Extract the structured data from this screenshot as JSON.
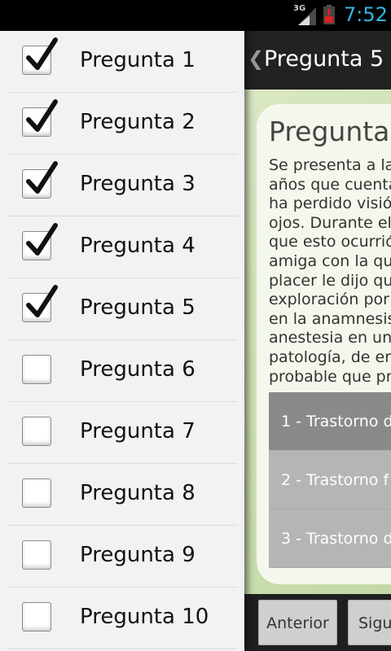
{
  "status_bar": {
    "network_label": "3G",
    "signal_icon": "signal-bars-icon",
    "battery_icon": "battery-low-icon",
    "time": "7:52",
    "time_color": "#33b5e5"
  },
  "content": {
    "action_bar": {
      "back_icon": "chevron-left-icon",
      "title": "Pregunta 5"
    },
    "question": {
      "title": "Pregunta",
      "text": "Se presenta a la\naños que cuenta\nha perdido visió\nojos. Durante el\nque esto ocurrió\namiga con la qu\nplacer le dijo que\nexploración por\nen la anamnesis\nanestesia en un\npatología, de ent\nprobable que pre"
    },
    "answers": [
      {
        "label": "1 - Trastorno d"
      },
      {
        "label": "2 - Trastorno f"
      },
      {
        "label": "3 - Trastorno d"
      }
    ],
    "buttons": {
      "previous": "Anterior",
      "next": "Sigu"
    }
  },
  "drawer": {
    "items": [
      {
        "label": "Pregunta 1",
        "checked": true
      },
      {
        "label": "Pregunta 2",
        "checked": true
      },
      {
        "label": "Pregunta 3",
        "checked": true
      },
      {
        "label": "Pregunta 4",
        "checked": true
      },
      {
        "label": "Pregunta 5",
        "checked": true
      },
      {
        "label": "Pregunta 6",
        "checked": false
      },
      {
        "label": "Pregunta 7",
        "checked": false
      },
      {
        "label": "Pregunta 8",
        "checked": false
      },
      {
        "label": "Pregunta 9",
        "checked": false
      },
      {
        "label": "Pregunta 10",
        "checked": false
      }
    ]
  }
}
